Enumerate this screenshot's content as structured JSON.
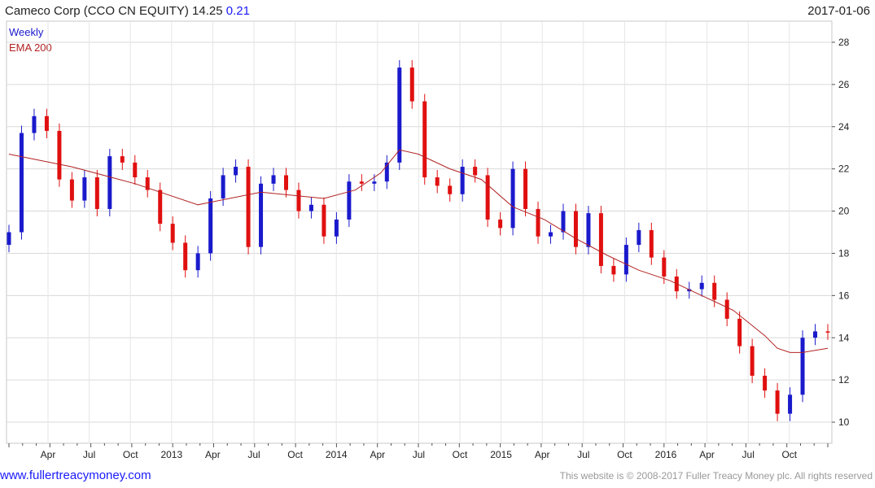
{
  "header": {
    "title_main": "Cameco Corp (CCO CN EQUITY) 14.25",
    "title_change": "0.21",
    "date": "2017-01-06"
  },
  "legend": {
    "series1": "Weekly",
    "series1_color": "#1a1acc",
    "series2": "EMA 200",
    "series2_color": "#b22222"
  },
  "footer": {
    "left": "www.fullertreacymoney.com",
    "right": "This website is © 2008-2017 Fuller Treacy Money plc. All rights reserved"
  },
  "colors": {
    "up": "#1a1acc",
    "down": "#e01010",
    "ema": "#b22222",
    "grid": "#d9d9d9"
  },
  "chart_data": {
    "type": "line",
    "title": "Cameco Corp (CCO CN EQUITY) 14.25 0.21",
    "ylim": [
      9,
      29
    ],
    "y_ticks": [
      10,
      12,
      14,
      16,
      18,
      20,
      22,
      24,
      26,
      28
    ],
    "x_tick_labels": [
      "Apr",
      "Jul",
      "Oct",
      "2013",
      "Apr",
      "Jul",
      "Oct",
      "2014",
      "Apr",
      "Jul",
      "Oct",
      "2015",
      "Apr",
      "Jul",
      "Oct",
      "2016",
      "Apr",
      "Jul",
      "Oct"
    ],
    "grid": true,
    "series": [
      {
        "name": "Weekly",
        "style": "candlestick",
        "x": [
          0,
          4,
          8,
          12,
          16,
          20,
          24,
          28,
          32,
          36,
          40,
          44,
          48,
          52,
          56,
          60,
          64,
          68,
          72,
          76,
          80,
          84,
          88,
          92,
          96,
          100,
          104,
          108,
          112,
          116,
          120,
          124,
          128,
          132,
          136,
          140,
          144,
          148,
          152,
          156,
          160,
          164,
          168,
          172,
          176,
          180,
          184,
          188,
          192,
          196,
          200,
          204,
          208,
          212,
          216,
          220,
          224,
          228,
          232,
          236,
          240,
          244,
          248,
          252,
          256,
          260
        ],
        "values": [
          19.0,
          23.7,
          24.5,
          23.8,
          21.5,
          20.5,
          21.6,
          20.1,
          22.6,
          22.3,
          21.6,
          21.0,
          19.4,
          18.5,
          17.2,
          18.0,
          20.6,
          21.7,
          22.1,
          18.3,
          21.3,
          21.7,
          21.0,
          20.0,
          20.3,
          18.8,
          19.6,
          21.4,
          21.3,
          21.4,
          22.3,
          26.8,
          25.2,
          21.6,
          21.2,
          20.8,
          22.1,
          21.7,
          19.6,
          19.2,
          22.0,
          20.1,
          18.8,
          19.0,
          20.0,
          18.3,
          19.9,
          17.4,
          17.0,
          18.4,
          19.1,
          17.8,
          16.9,
          16.2,
          16.3,
          16.6,
          15.8,
          14.9,
          13.6,
          12.2,
          11.5,
          10.4,
          11.3,
          14.0,
          14.3,
          14.25
        ]
      },
      {
        "name": "EMA 200",
        "style": "line",
        "x": [
          0,
          20,
          40,
          60,
          80,
          100,
          110,
          118,
          124,
          130,
          140,
          150,
          160,
          170,
          180,
          190,
          200,
          210,
          220,
          230,
          240,
          244,
          248,
          252,
          256,
          260
        ],
        "values": [
          22.7,
          22.1,
          21.3,
          20.3,
          20.9,
          20.6,
          21.0,
          21.8,
          22.9,
          22.7,
          22.0,
          21.5,
          20.2,
          19.6,
          18.7,
          17.9,
          17.2,
          16.7,
          16.0,
          15.3,
          14.1,
          13.5,
          13.3,
          13.3,
          13.4,
          13.5
        ]
      }
    ]
  }
}
